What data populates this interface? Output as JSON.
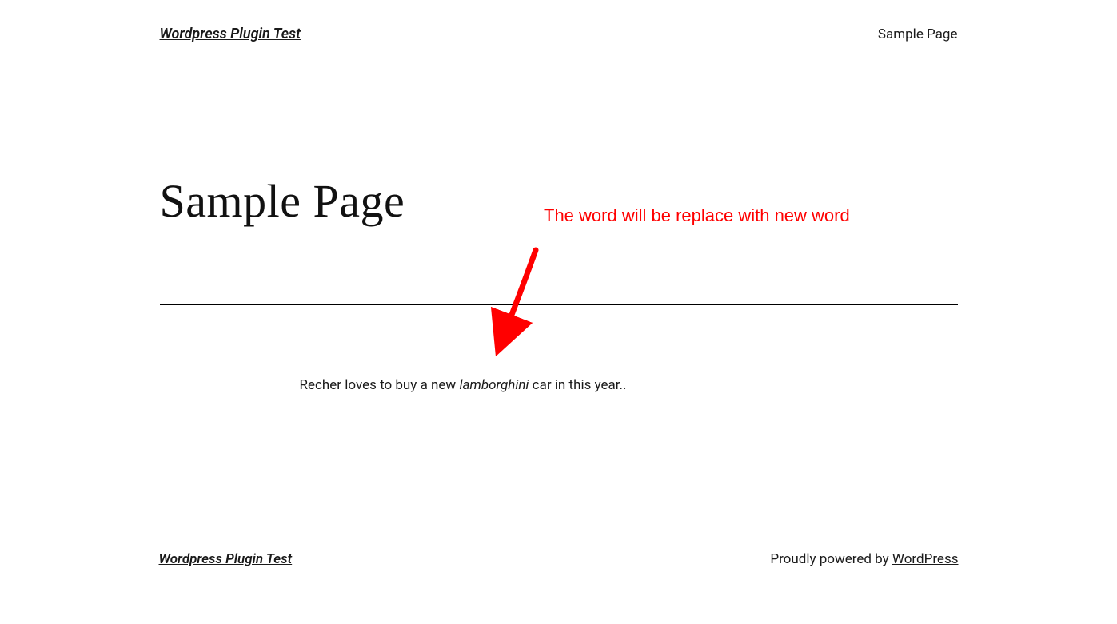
{
  "header": {
    "site_title": "Wordpress Plugin Test",
    "nav_link": "Sample Page"
  },
  "page": {
    "title": "Sample Page",
    "paragraph_prefix": "Recher loves to buy a new ",
    "paragraph_em": "lamborghini",
    "paragraph_suffix": " car in this year.."
  },
  "annotation": {
    "text": "The word will be replace with new word",
    "arrow_color": "#ff0000"
  },
  "footer": {
    "site_title": "Wordpress Plugin Test",
    "powered_prefix": "Proudly powered by ",
    "powered_link": "WordPress"
  }
}
